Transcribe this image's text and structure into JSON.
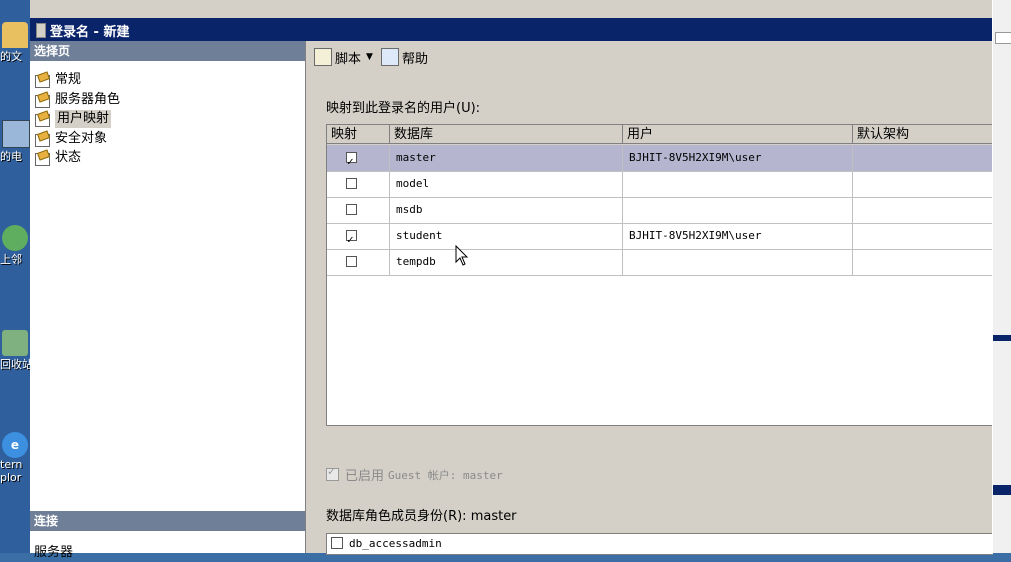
{
  "window": {
    "title": "登录名 - 新建"
  },
  "desktop_icons": [
    {
      "label": "的文",
      "icon": "folder-icon"
    },
    {
      "label": "的电",
      "icon": "computer-icon"
    },
    {
      "label": "上邻",
      "icon": "network-icon"
    },
    {
      "label": "回收站",
      "icon": "recycle-bin-icon"
    },
    {
      "label": "tern plor",
      "icon": "ie-icon"
    }
  ],
  "left_pane": {
    "select_page_header": "选择页",
    "pages": [
      {
        "label": "常规",
        "icon": "page-icon"
      },
      {
        "label": "服务器角色",
        "icon": "page-icon"
      },
      {
        "label": "用户映射",
        "icon": "page-icon",
        "selected": true
      },
      {
        "label": "安全对象",
        "icon": "page-icon"
      },
      {
        "label": "状态",
        "icon": "page-icon"
      }
    ],
    "connection_header": "连接",
    "connection_item": "服务器"
  },
  "toolbar": {
    "script_label": "脚本",
    "help_label": "帮助"
  },
  "mapping": {
    "label": "映射到此登录名的用户(U):",
    "columns": [
      "映射",
      "数据库",
      "用户",
      "默认架构"
    ],
    "rows": [
      {
        "mapped": true,
        "database": "master",
        "user": "BJHIT-8V5H2XI9M\\user",
        "schema": "",
        "selected": true
      },
      {
        "mapped": false,
        "database": "model",
        "user": "",
        "schema": ""
      },
      {
        "mapped": false,
        "database": "msdb",
        "user": "",
        "schema": ""
      },
      {
        "mapped": true,
        "database": "student",
        "user": "BJHIT-8V5H2XI9M\\user",
        "schema": ""
      },
      {
        "mapped": false,
        "database": "tempdb",
        "user": "",
        "schema": ""
      }
    ]
  },
  "guest": {
    "label": "已启用",
    "text": "Guest 帐户: master"
  },
  "roles": {
    "label": "数据库角色成员身份(R): master",
    "items": [
      "db_accessadmin"
    ]
  }
}
